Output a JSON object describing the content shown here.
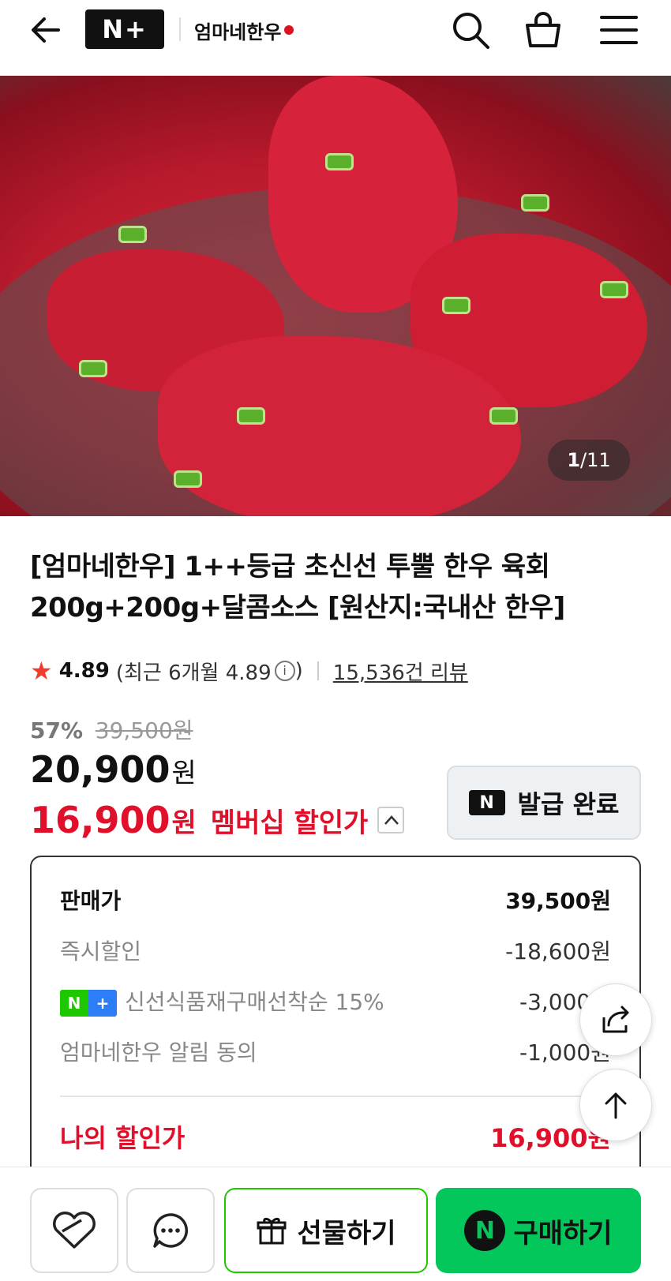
{
  "header": {
    "logo_text": "N+",
    "brand_name": "엄마네한우"
  },
  "hero": {
    "counter_current": "1",
    "counter_total": "/11"
  },
  "product": {
    "title_line1": "[엄마네한우] 1++등급 초신선 투뿔 한우 육회",
    "title_line2": "200g+200g+달콤소스 [원산지:국내산 한우]",
    "rating_score": "4.89",
    "rating_recent": "(최근 6개월 4.89",
    "rating_close": ")",
    "review_count": "15,536건 리뷰"
  },
  "price": {
    "discount_rate": "57%",
    "original_price": "39,500원",
    "sale_price": "20,900",
    "won": "원",
    "member_price": "16,900",
    "member_label": "멤버십 할인가",
    "coupon_badge": "N",
    "coupon_label": "발급 완료"
  },
  "breakdown": {
    "rows": [
      {
        "label": "판매가",
        "amount": "39,500원"
      },
      {
        "label": "즉시할인",
        "amount": "-18,600원"
      },
      {
        "label": "신선식품재구매선착순 15%",
        "amount": "-3,000원"
      },
      {
        "label": "엄마네한우 알림 동의",
        "amount": "-1,000원"
      }
    ],
    "final_label": "나의 할인가",
    "final_amount": "16,900원"
  },
  "bottom": {
    "gift_label": "선물하기",
    "buy_label": "구매하기",
    "buy_badge": "N"
  }
}
